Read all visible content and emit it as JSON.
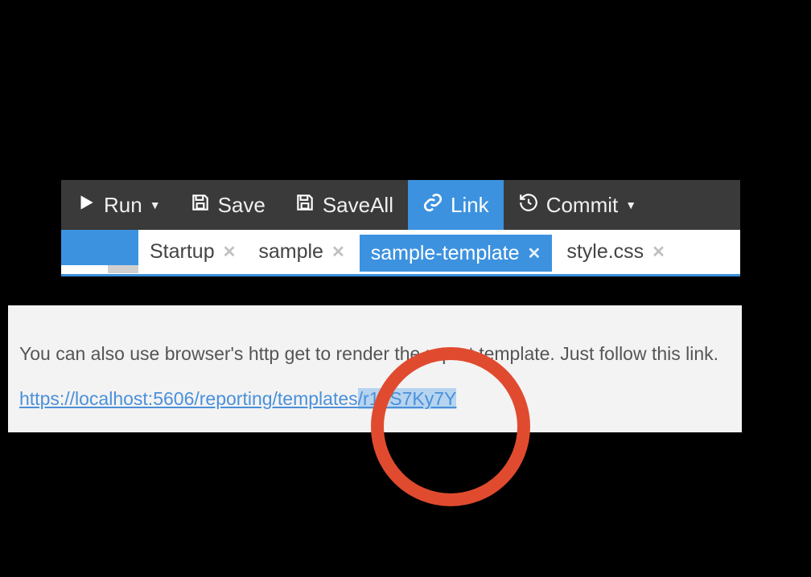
{
  "toolbar": {
    "run": {
      "label": "Run"
    },
    "save": {
      "label": "Save"
    },
    "saveall": {
      "label": "SaveAll"
    },
    "link": {
      "label": "Link"
    },
    "commit": {
      "label": "Commit"
    }
  },
  "tabs": [
    {
      "label": "Startup",
      "active": false
    },
    {
      "label": "sample",
      "active": false
    },
    {
      "label": "sample-template",
      "active": true
    },
    {
      "label": "style.css",
      "active": false
    }
  ],
  "info": {
    "text": "You can also use browser's http get to render the report template. Just follow this link.",
    "link_prefix": "https://localhost:5606/reporting/templates",
    "link_highlighted": "/r10S7Ky7Y"
  }
}
